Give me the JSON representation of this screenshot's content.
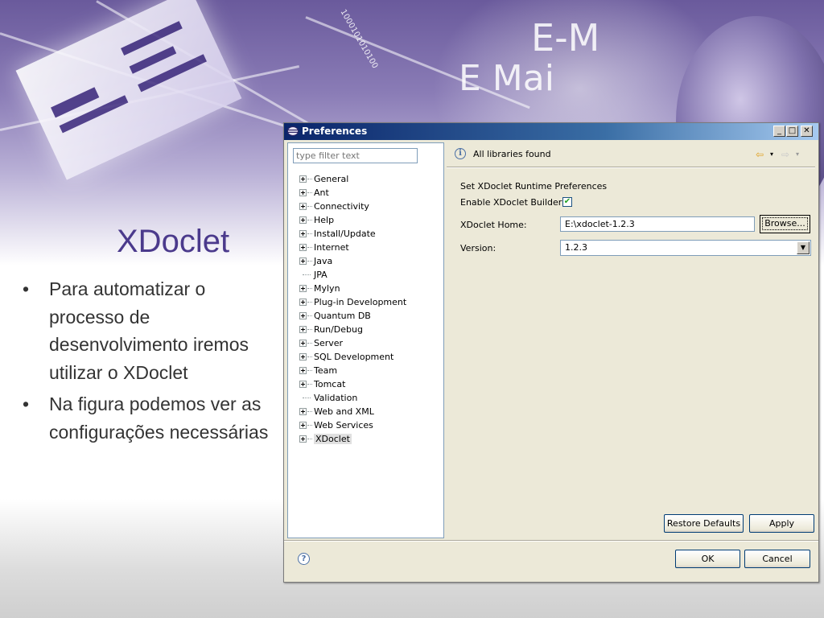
{
  "slide": {
    "title": "XDoclet",
    "bullets": [
      "Para automatizar o processo de desenvolvimento iremos utilizar o XDoclet",
      "Na figura podemos ver as configurações necessárias"
    ],
    "background_text": {
      "email_1": "E-M",
      "email_2": "E Mai",
      "binary": "1000101010100"
    },
    "colors": {
      "title": "#4b3a8c",
      "banner": "#6a5a9c"
    }
  },
  "window": {
    "title": "Preferences",
    "filter_placeholder": "type filter text",
    "tree": [
      {
        "label": "General",
        "expandable": true
      },
      {
        "label": "Ant",
        "expandable": true
      },
      {
        "label": "Connectivity",
        "expandable": true
      },
      {
        "label": "Help",
        "expandable": true
      },
      {
        "label": "Install/Update",
        "expandable": true
      },
      {
        "label": "Internet",
        "expandable": true
      },
      {
        "label": "Java",
        "expandable": true
      },
      {
        "label": "JPA",
        "expandable": false
      },
      {
        "label": "Mylyn",
        "expandable": true
      },
      {
        "label": "Plug-in Development",
        "expandable": true
      },
      {
        "label": "Quantum DB",
        "expandable": true
      },
      {
        "label": "Run/Debug",
        "expandable": true
      },
      {
        "label": "Server",
        "expandable": true
      },
      {
        "label": "SQL Development",
        "expandable": true
      },
      {
        "label": "Team",
        "expandable": true
      },
      {
        "label": "Tomcat",
        "expandable": true
      },
      {
        "label": "Validation",
        "expandable": false
      },
      {
        "label": "Web and XML",
        "expandable": true
      },
      {
        "label": "Web Services",
        "expandable": true
      },
      {
        "label": "XDoclet",
        "expandable": true,
        "selected": true
      }
    ],
    "info_message": "All libraries found",
    "form": {
      "heading": "Set XDoclet Runtime Preferences",
      "enable_label": "Enable XDoclet Builder:",
      "enable_checked": "✔",
      "home_label": "XDoclet Home:",
      "home_value": "E:\\xdoclet-1.2.3",
      "browse_label": "Browse...",
      "version_label": "Version:",
      "version_value": "1.2.3"
    },
    "buttons": {
      "restore_defaults": "Restore Defaults",
      "apply": "Apply",
      "ok": "OK",
      "cancel": "Cancel"
    },
    "icons": {
      "info": "info-icon",
      "help": "help-icon",
      "back": "back-arrow-icon",
      "forward": "forward-arrow-icon"
    }
  }
}
